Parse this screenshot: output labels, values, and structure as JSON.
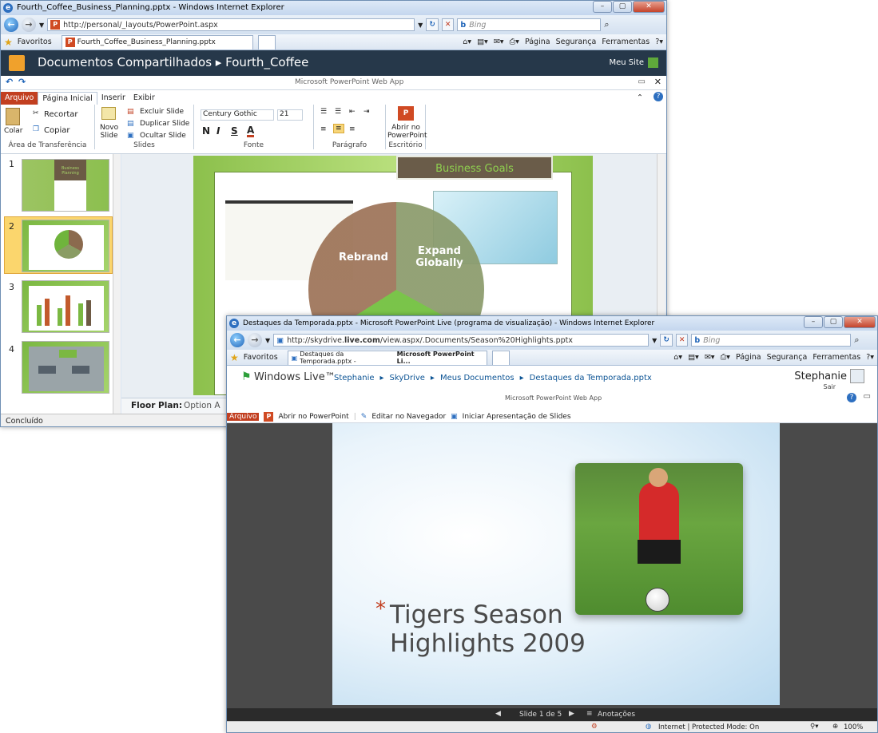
{
  "win1": {
    "title": "Fourth_Coffee_Business_Planning.pptx - Windows Internet Explorer",
    "url": "http://personal/_layouts/PowerPoint.aspx",
    "search_placeholder": "Bing",
    "favorites": "Favoritos",
    "tab": "Fourth_Coffee_Business_Planning.pptx",
    "tools": [
      "Página",
      "Segurança",
      "Ferramentas"
    ],
    "breadcrumb": "Documentos Compartilhados ▸ Fourth_Coffee",
    "meu_site": "Meu Site",
    "app_name": "Microsoft PowerPoint Web App",
    "ribbon_tabs": [
      "Arquivo",
      "Página Inicial",
      "Inserir",
      "Exibir"
    ],
    "clip": {
      "paste": "Colar",
      "cut": "Recortar",
      "copy": "Copiar",
      "label": "Área de Transferência"
    },
    "slides": {
      "new1": "Novo",
      "new2": "Slide",
      "delete": "Excluir Slide",
      "dup": "Duplicar Slide",
      "hide": "Ocultar Slide",
      "label": "Slides"
    },
    "font": {
      "name": "Century Gothic",
      "size": "21",
      "bold": "N",
      "italic": "I",
      "underline": "S",
      "color": "A",
      "label": "Fonte"
    },
    "para_label": "Parágrafo",
    "office": {
      "open1": "Abrir no",
      "open2": "PowerPoint",
      "label": "Escritório"
    },
    "slide_numbers": [
      "1",
      "2",
      "3",
      "4"
    ],
    "slide_title": "Business Goals",
    "segments": [
      "Rebrand",
      "Expand\nGlobally"
    ],
    "thumb1_title": "Business Planning",
    "notes": "Floor Plan:",
    "notes_rest": "Option A",
    "status": "Concluído",
    "colors": {
      "accent": "#c23f20",
      "dark": "#26384a",
      "green": "#7bb842"
    }
  },
  "win2": {
    "title": "Destaques da Temporada.pptx - Microsoft PowerPoint Live (programa de visualização) - Windows Internet Explorer",
    "url_pre": "http://skydrive.",
    "url_bold": "live.com",
    "url_post": "/view.aspx/.Documents/Season%20Highlights.pptx",
    "search_placeholder": "Bing",
    "favorites": "Favoritos",
    "tab_pre": "Destaques da Temporada.pptx - ",
    "tab_bold": "Microsoft PowerPoint Li...",
    "tools": [
      "Página",
      "Segurança",
      "Ferramentas"
    ],
    "brand": "Windows Live™",
    "crumbs": [
      "Stephanie",
      "SkyDrive",
      "Meus Documentos",
      "Destaques da Temporada.pptx"
    ],
    "user": "Stephanie",
    "sair": "Sair",
    "app_name": "Microsoft PowerPoint Web App",
    "file": "Arquivo",
    "actions": [
      "Abrir no PowerPoint",
      "Editar no Navegador",
      "Iniciar Apresentação de Slides"
    ],
    "slide_title_1": "Tigers Season",
    "slide_title_2": "Highlights 2009",
    "asterisk": "*",
    "slide_counter": "Slide 1 de 5",
    "notes": "Anotações",
    "status_zone": "Internet | Protected Mode: On",
    "zoom": "100%"
  }
}
